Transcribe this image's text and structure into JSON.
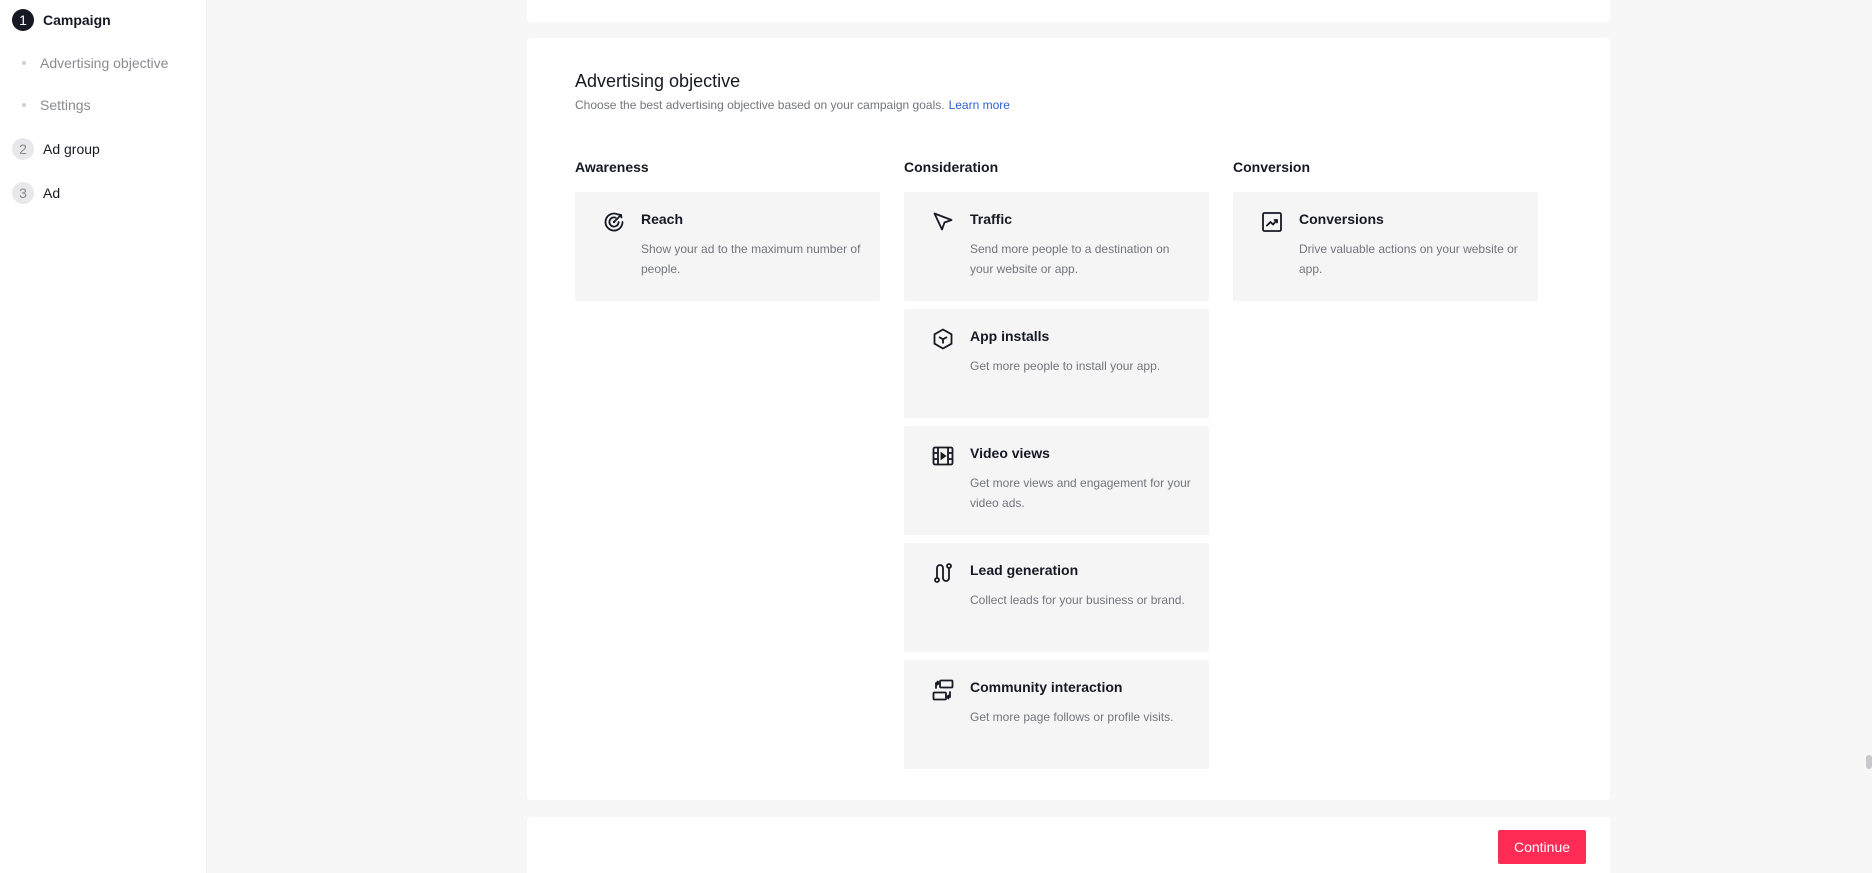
{
  "sidebar": {
    "steps": [
      {
        "number": "1",
        "label": "Campaign",
        "active": true
      },
      {
        "number": "2",
        "label": "Ad group",
        "active": false
      },
      {
        "number": "3",
        "label": "Ad",
        "active": false
      }
    ],
    "substeps": [
      {
        "label": "Advertising objective"
      },
      {
        "label": "Settings"
      }
    ]
  },
  "objective": {
    "title": "Advertising objective",
    "description": "Choose the best advertising objective based on your campaign goals.",
    "learn_more": "Learn more"
  },
  "columns": [
    {
      "title": "Awareness",
      "cards": [
        {
          "icon": "target-icon",
          "title": "Reach",
          "description": "Show your ad to the maximum number of people."
        }
      ]
    },
    {
      "title": "Consideration",
      "cards": [
        {
          "icon": "cursor-arrow-icon",
          "title": "Traffic",
          "description": "Send more people to a destination on your website or app."
        },
        {
          "icon": "cube-icon",
          "title": "App installs",
          "description": "Get more people to install your app."
        },
        {
          "icon": "film-icon",
          "title": "Video views",
          "description": "Get more views and engagement for your video ads."
        },
        {
          "icon": "route-icon",
          "title": "Lead generation",
          "description": "Collect leads for your business or brand."
        },
        {
          "icon": "interaction-icon",
          "title": "Community interaction",
          "description": "Get more page follows or profile visits."
        }
      ]
    },
    {
      "title": "Conversion",
      "cards": [
        {
          "icon": "trending-chart-icon",
          "title": "Conversions",
          "description": "Drive valuable actions on your website or app."
        }
      ]
    }
  ],
  "footer": {
    "continue_label": "Continue"
  },
  "colors": {
    "accent": "#fe2c55",
    "link": "#2a62d9",
    "card_bg": "#f5f5f5",
    "page_bg": "#f7f7f8"
  }
}
